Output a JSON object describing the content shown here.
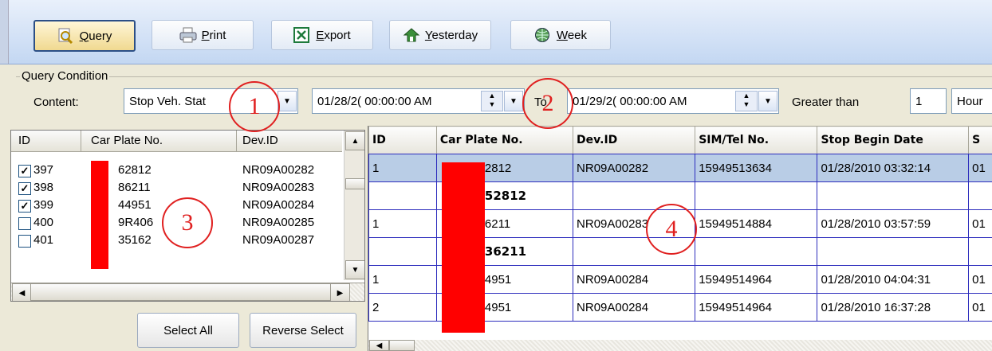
{
  "toolbar": {
    "buttons": [
      {
        "label": "Query",
        "icon": "magnifier-icon"
      },
      {
        "label": "Print",
        "icon": "printer-icon"
      },
      {
        "label": "Export",
        "icon": "excel-export-icon"
      },
      {
        "label": "Yesterday",
        "icon": "calendar-back-icon"
      },
      {
        "label": "Week",
        "icon": "globe-week-icon"
      }
    ]
  },
  "query_condition": {
    "group_label": "Query Condition",
    "content_label": "Content:",
    "content_value": "Stop Veh. Stat",
    "from_datetime": "01/28/2( 00:00:00 AM",
    "to_label": "To",
    "to_datetime": "01/29/2( 00:00:00 AM",
    "greater_than_label": "Greater than",
    "greater_than_value": "1",
    "unit_value": "Hour"
  },
  "annotations": [
    "1",
    "2",
    "3",
    "4"
  ],
  "vehicle_list": {
    "columns": [
      "ID",
      "Car Plate No.",
      "Dev.ID"
    ],
    "rows": [
      {
        "id": "397",
        "plate": "62812",
        "dev": "NR09A00282",
        "checked": true
      },
      {
        "id": "398",
        "plate": "86211",
        "dev": "NR09A00283",
        "checked": true
      },
      {
        "id": "399",
        "plate": "44951",
        "dev": "NR09A00284",
        "checked": true
      },
      {
        "id": "400",
        "plate": "9R406",
        "dev": "NR09A00285",
        "checked": false
      },
      {
        "id": "401",
        "plate": "35162",
        "dev": "NR09A00287",
        "checked": false
      }
    ],
    "select_all_label": "Select All",
    "reverse_select_label": "Reverse Select"
  },
  "results": {
    "columns": [
      "ID",
      "Car Plate No.",
      "Dev.ID",
      "SIM/Tel No.",
      "Stop Begin Date",
      "S"
    ],
    "rows": [
      {
        "cells": [
          "1",
          "2812",
          "NR09A00282",
          "15949513634",
          "01/28/2010 03:32:14",
          "01"
        ],
        "selected": true
      },
      {
        "cells": [
          "",
          "52812",
          "",
          "",
          "",
          ""
        ],
        "group": true
      },
      {
        "cells": [
          "1",
          "6211",
          "NR09A00283",
          "15949514884",
          "01/28/2010 03:57:59",
          "01"
        ]
      },
      {
        "cells": [
          "",
          "36211",
          "",
          "",
          "",
          ""
        ],
        "group": true
      },
      {
        "cells": [
          "1",
          "4951",
          "NR09A00284",
          "15949514964",
          "01/28/2010 04:04:31",
          "01"
        ]
      },
      {
        "cells": [
          "2",
          "4951",
          "NR09A00284",
          "15949514964",
          "01/28/2010 16:37:28",
          "01"
        ]
      }
    ]
  },
  "colors": {
    "toolbar_bg": "#c3d7f2",
    "annotation": "#e02020",
    "redaction": "#ff0000",
    "selected_row": "#b9cde6",
    "grid_line": "#2d2dbd"
  }
}
